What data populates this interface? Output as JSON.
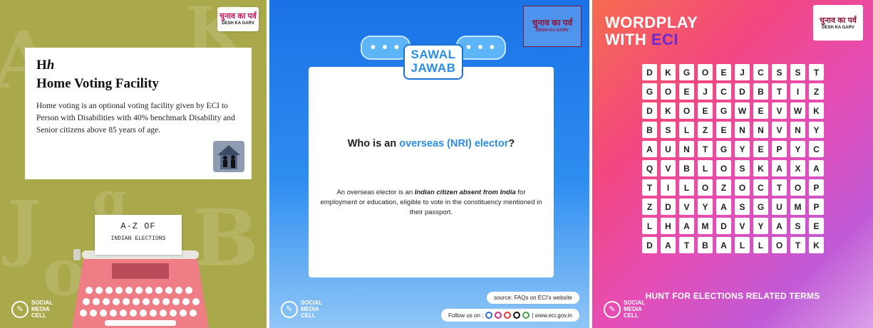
{
  "panel1": {
    "letter_upper": "H",
    "letter_lower": "h",
    "title": "Home Voting Facility",
    "description": "Home voting is an optional voting facility given by ECI to Person with Disabilities with 40% benchmark Disability and Senior citizens above 85 years of age.",
    "paper_line1": "A-Z OF",
    "paper_line2": "INDIAN ELECTIONS",
    "logo_hindi": "चुनाव का पर्व",
    "logo_english": "DESH KA GARV",
    "smc": [
      "SOCIAL",
      "MEDIA",
      "CELL"
    ],
    "bg_color": "#a9a84a",
    "typewriter_color": "#ee7d86"
  },
  "panel2": {
    "logo_hindi": "चुनाव का पर्व",
    "logo_english": "DESH KA GARV",
    "badge_line1": "SAWAL",
    "badge_line2": "JAWAB",
    "bubble_dots": "• • •",
    "question_prefix": "Who is an ",
    "question_highlight": "overseas (NRI) elector",
    "question_suffix": "?",
    "answer_pre": "An overseas elector is an ",
    "answer_bold": "Indian citizen absent from India",
    "answer_post": " for employment or education, eligible to vote in the constituency mentioned in their passport.",
    "source": "source: FAQs on ECI's website",
    "follow_label": "Follow us on :",
    "website": "| www.eci.gov.in",
    "smc": [
      "SOCIAL",
      "MEDIA",
      "CELL"
    ]
  },
  "panel3": {
    "title_line1": "WORDPLAY",
    "title_line2_prefix": "WITH ",
    "title_line2_highlight": "ECI",
    "logo_hindi": "चुनाव का पर्व",
    "logo_english": "DESH KA GARV",
    "grid": [
      [
        "D",
        "K",
        "G",
        "O",
        "E",
        "J",
        "C",
        "S",
        "S",
        "T"
      ],
      [
        "G",
        "O",
        "E",
        "J",
        "C",
        "D",
        "B",
        "T",
        "I",
        "Z"
      ],
      [
        "D",
        "K",
        "O",
        "E",
        "G",
        "W",
        "E",
        "V",
        "W",
        "K"
      ],
      [
        "B",
        "S",
        "L",
        "Z",
        "E",
        "N",
        "N",
        "V",
        "N",
        "Y"
      ],
      [
        "A",
        "U",
        "N",
        "T",
        "G",
        "Y",
        "E",
        "P",
        "Y",
        "C"
      ],
      [
        "Q",
        "V",
        "B",
        "L",
        "O",
        "S",
        "K",
        "A",
        "X",
        "A"
      ],
      [
        "T",
        "I",
        "L",
        "O",
        "Z",
        "O",
        "C",
        "T",
        "O",
        "P"
      ],
      [
        "Z",
        "D",
        "V",
        "Y",
        "A",
        "S",
        "G",
        "U",
        "M",
        "P"
      ],
      [
        "L",
        "H",
        "A",
        "M",
        "D",
        "V",
        "Y",
        "A",
        "S",
        "E"
      ],
      [
        "D",
        "A",
        "T",
        "B",
        "A",
        "L",
        "L",
        "O",
        "T",
        "K"
      ]
    ],
    "hunt": "HUNT FOR ELECTIONS RELATED TERMS",
    "smc": [
      "SOCIAL",
      "MEDIA",
      "CELL"
    ]
  }
}
